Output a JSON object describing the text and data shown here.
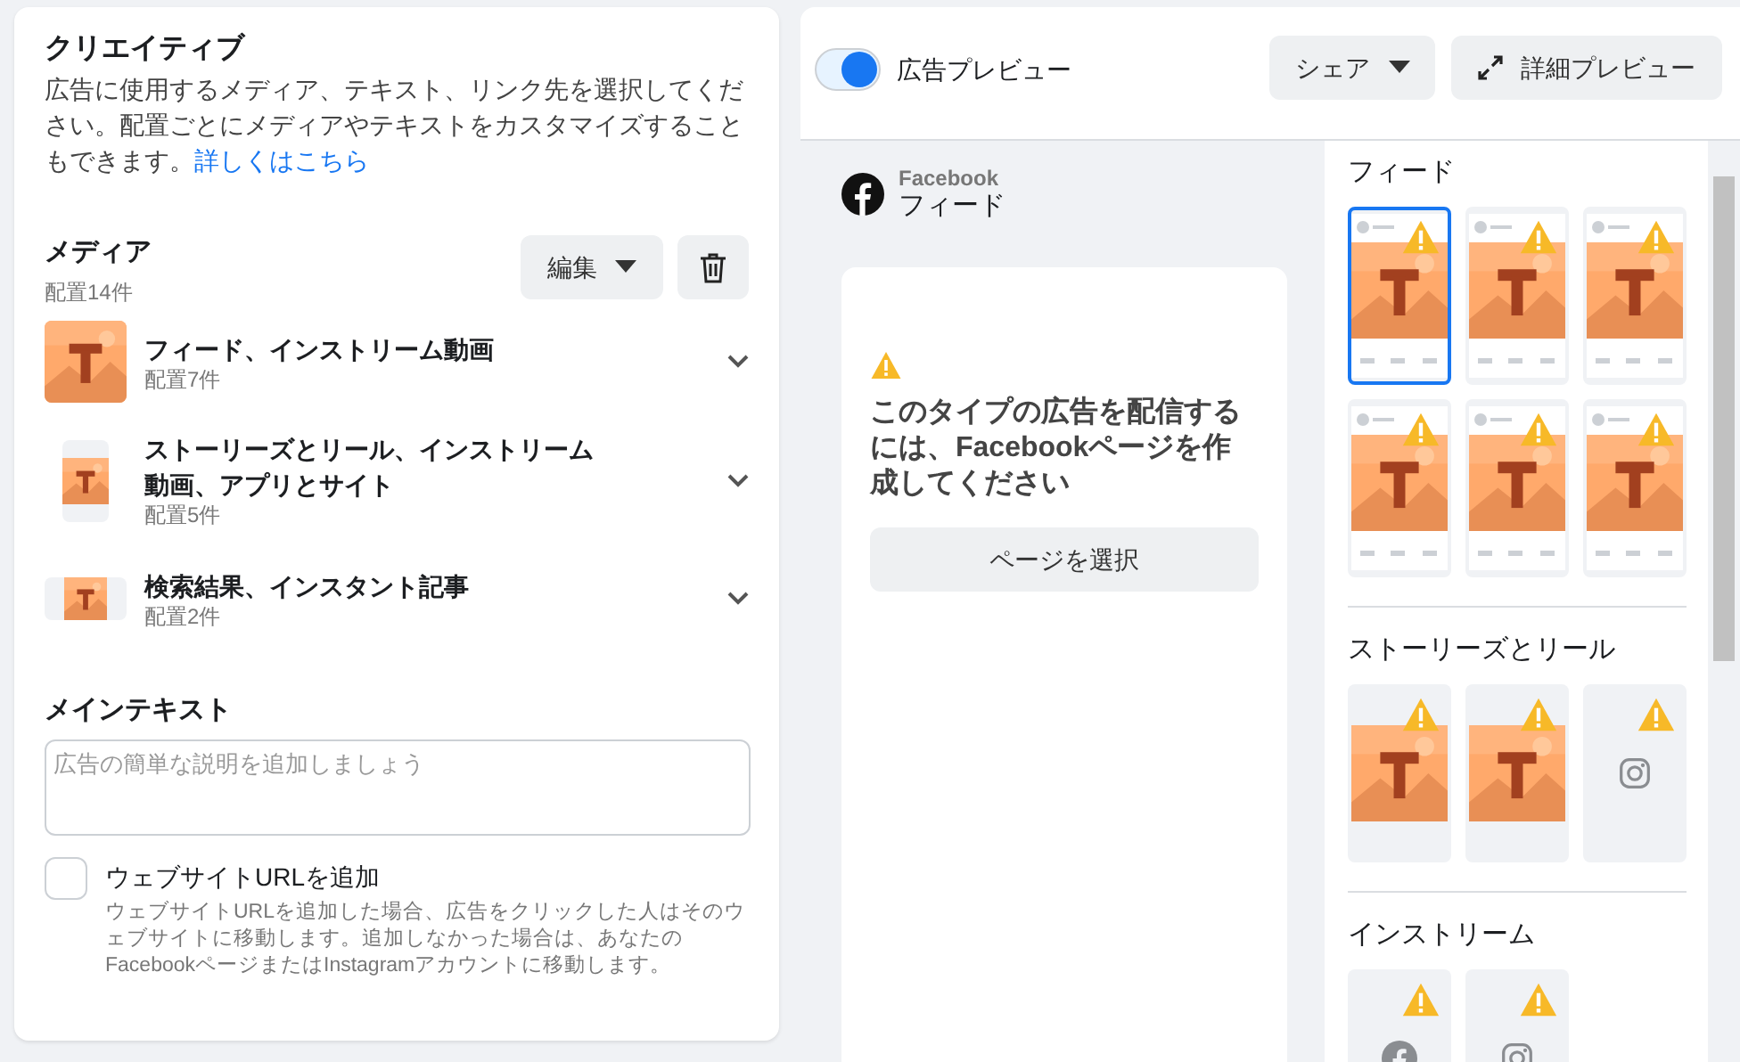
{
  "creative": {
    "title": "クリエイティブ",
    "description": "広告に使用するメディア、テキスト、リンク先を選択してください。配置ごとにメディアやテキストをカスタマイズすることもできます。",
    "learn_more_link": "詳しくはこちら",
    "media": {
      "title": "メディア",
      "count": "配置14件",
      "edit_button": "編集",
      "items": [
        {
          "kind": "square",
          "title": "フィード、インストリーム動画",
          "count": "配置7件"
        },
        {
          "kind": "vertical",
          "title": "ストーリーズとリール、インストリーム動画、アプリとサイト",
          "count": "配置5件"
        },
        {
          "kind": "horizontal",
          "title": "検索結果、インスタント記事",
          "count": "配置2件"
        }
      ]
    },
    "main_text": {
      "label": "メインテキスト",
      "placeholder": "広告の簡単な説明を追加しましょう"
    },
    "website_url": {
      "label": "ウェブサイトURLを追加",
      "checked": false,
      "help": "ウェブサイトURLを追加した場合、広告をクリックした人はそのウェブサイトに移動します。追加しなかった場合は、あなたのFacebookページまたはInstagramアカウントに移動します。"
    }
  },
  "preview": {
    "toggle": {
      "label": "広告プレビュー",
      "on": true
    },
    "share_button": "シェア",
    "full_preview_button": "詳細プレビュー",
    "platform": "Facebook",
    "placement": "フィード",
    "warning": "このタイプの広告を配信するには、Facebookページを作成してください",
    "select_page_button": "ページを選択",
    "sections": [
      {
        "title": "フィード",
        "thumbnails": [
          {
            "kind": "feed",
            "selected": true,
            "warning": true
          },
          {
            "kind": "feed",
            "selected": false,
            "warning": true
          },
          {
            "kind": "feed",
            "selected": false,
            "warning": true
          },
          {
            "kind": "feed",
            "selected": false,
            "warning": true
          },
          {
            "kind": "feed",
            "selected": false,
            "warning": true
          },
          {
            "kind": "feed",
            "selected": false,
            "warning": true
          }
        ]
      },
      {
        "title": "ストーリーズとリール",
        "thumbnails": [
          {
            "kind": "story",
            "selected": false,
            "warning": true
          },
          {
            "kind": "story",
            "selected": false,
            "warning": true
          },
          {
            "kind": "instagram",
            "selected": false,
            "warning": true
          }
        ]
      },
      {
        "title": "インストリーム",
        "thumbnails": [
          {
            "kind": "facebook",
            "selected": false,
            "warning": true
          },
          {
            "kind": "instagram",
            "selected": false,
            "warning": true
          }
        ]
      }
    ]
  }
}
